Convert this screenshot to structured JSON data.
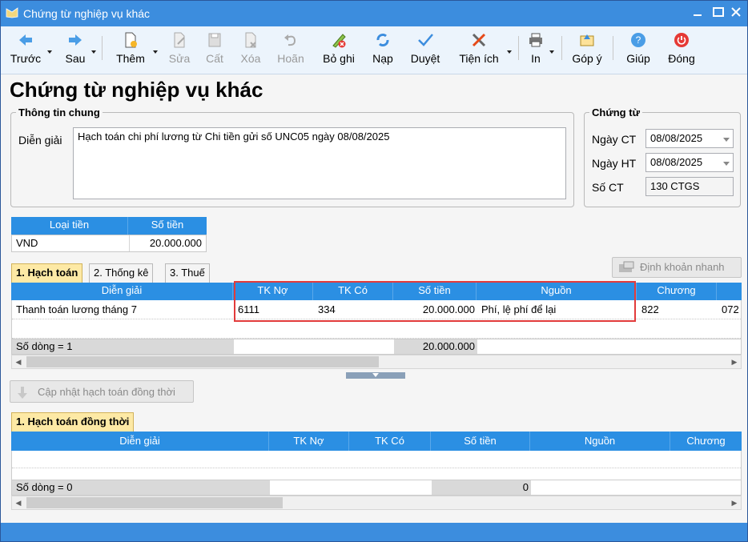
{
  "window": {
    "title": "Chứng từ nghiệp vụ khác"
  },
  "toolbar": {
    "prev": "Trước",
    "next": "Sau",
    "add": "Thêm",
    "edit": "Sửa",
    "cut": "Cất",
    "delete": "Xóa",
    "undo": "Hoãn",
    "post": "Bỏ ghi",
    "reload": "Nạp",
    "approve": "Duyệt",
    "utilities": "Tiện ích",
    "print": "In",
    "feedback": "Góp ý",
    "help": "Giúp",
    "close": "Đóng"
  },
  "page": {
    "title": "Chứng từ nghiệp vụ khác"
  },
  "general": {
    "legend": "Thông tin chung",
    "desc_label": "Diễn giải",
    "desc_value": "Hạch toán chi phí lương từ Chi tiền gửi số UNC05 ngày 08/08/2025"
  },
  "voucher": {
    "legend": "Chứng từ",
    "date_ct_label": "Ngày CT",
    "date_ct": "08/08/2025",
    "date_ht_label": "Ngày HT",
    "date_ht": "08/08/2025",
    "no_label": "Số CT",
    "no": "130 CTGS"
  },
  "currency": {
    "col1": "Loại tiền",
    "col2": "Số tiền",
    "type": "VND",
    "amount": "20.000.000"
  },
  "tabs": {
    "t1": "1. Hạch toán",
    "t2": "2. Thống kê",
    "t3": "3. Thuế",
    "quick": "Định khoản nhanh"
  },
  "grid1": {
    "headers": [
      "Diễn giải",
      "TK Nợ",
      "TK Có",
      "Số tiền",
      "Nguồn",
      "Chương"
    ],
    "row": {
      "desc": "Thanh toán lương tháng 7",
      "debit": "6111",
      "credit": "334",
      "amount": "20.000.000",
      "source": "Phí, lệ phí để lại",
      "chapter": "822",
      "extra": "072"
    },
    "footer_label": "Số dòng = 1",
    "footer_total": "20.000.000"
  },
  "update_btn": "Cập nhật hạch toán đồng thời",
  "tab_concurrent": "1. Hạch toán đồng thời",
  "grid2": {
    "headers": [
      "Diễn giải",
      "TK Nợ",
      "TK Có",
      "Số tiền",
      "Nguồn",
      "Chương"
    ],
    "footer_label": "Số dòng = 0",
    "footer_total": "0"
  },
  "colors": {
    "accent": "#3c8dde",
    "header": "#2b8fe3",
    "highlight": "#e23b3b",
    "tab_active": "#fde9a5"
  }
}
